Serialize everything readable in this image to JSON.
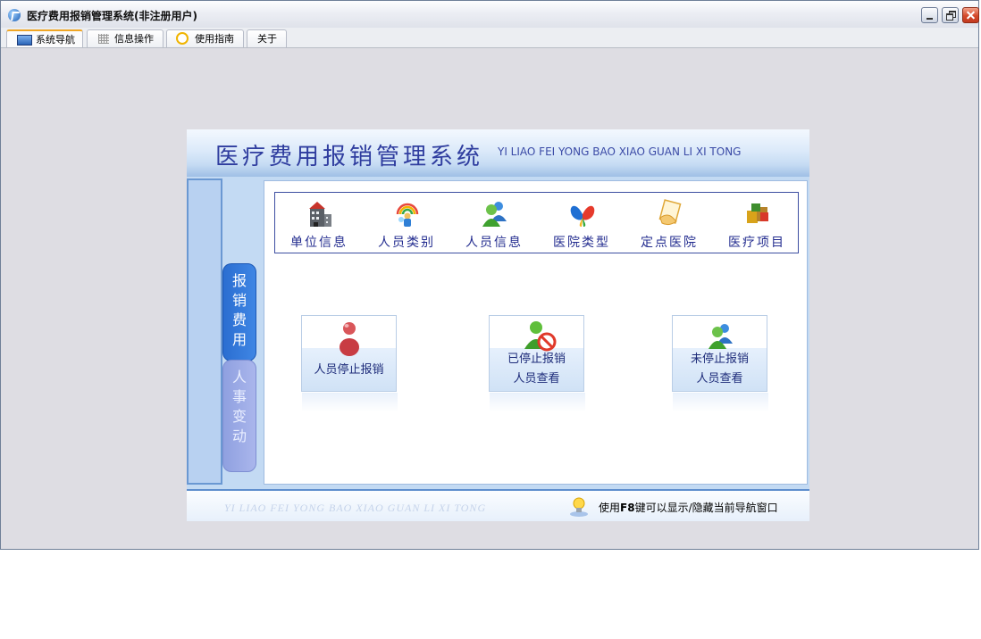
{
  "window": {
    "title": "医疗费用报销管理系统(非注册用户)",
    "controls": [
      "minimize-icon",
      "restore-icon",
      "close-icon"
    ]
  },
  "tabs": [
    {
      "label": "系统导航",
      "icon": "monitor-icon",
      "active": true
    },
    {
      "label": "信息操作",
      "icon": "grid-icon",
      "active": false
    },
    {
      "label": "使用指南",
      "icon": "help-ring-icon",
      "active": false
    },
    {
      "label": "关于",
      "icon": "",
      "active": false
    }
  ],
  "banner": {
    "title_cn": "医疗费用报销管理系统",
    "title_en": "YI LIAO FEI YONG BAO XIAO GUAN LI XI TONG"
  },
  "side_tabs": [
    {
      "label": "报\n销\n费\n用",
      "active": true
    },
    {
      "label": "人\n事\n变\n动",
      "active": false
    }
  ],
  "tools": [
    {
      "label": "单位信息",
      "icon": "building-icon"
    },
    {
      "label": "人员类别",
      "icon": "rainbow-people-icon"
    },
    {
      "label": "人员信息",
      "icon": "users-icon"
    },
    {
      "label": "医院类型",
      "icon": "butterfly-icon"
    },
    {
      "label": "定点医院",
      "icon": "document-hand-icon"
    },
    {
      "label": "医疗项目",
      "icon": "boxes-icon"
    }
  ],
  "cards": [
    {
      "line1": "人员停止报销",
      "line2": "",
      "icon": "person-red-icon"
    },
    {
      "line1": "已停止报销",
      "line2": "人员查看",
      "icon": "user-stop-icon"
    },
    {
      "line1": "未停止报销",
      "line2": "人员查看",
      "icon": "users-icon"
    }
  ],
  "footer": {
    "watermark": "YI LIAO FEI YONG BAO XIAO GUAN LI XI TONG",
    "tip_prefix": "使用",
    "tip_key": "F8",
    "tip_suffix": "键可以显示/隐藏当前导航窗口"
  },
  "colors": {
    "title_blue": "#2f3d9f",
    "tab_active_accent": "#f0a624",
    "side_tab_active": "#2b6ed1",
    "side_tab_inactive": "#8fa0e0"
  }
}
